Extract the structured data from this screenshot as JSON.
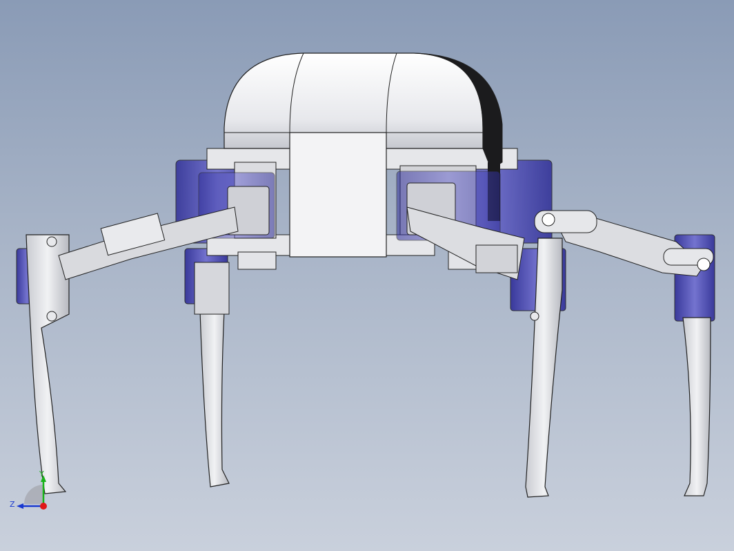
{
  "viewport": {
    "background_top": "#8a9bb6",
    "background_bottom": "#c9d0dc"
  },
  "model": {
    "part_colors": {
      "shell": "#ececef",
      "shell_shadow": "#1a1a1a",
      "frame": "#e3e4e8",
      "servo": "#3b3aa8",
      "servo_light": "#7a78d0",
      "outline": "#202020"
    }
  },
  "triad": {
    "y_label": "Y",
    "z_label": "Z",
    "x_color": "#e01818",
    "y_color": "#18b418",
    "z_color": "#1838d0"
  }
}
